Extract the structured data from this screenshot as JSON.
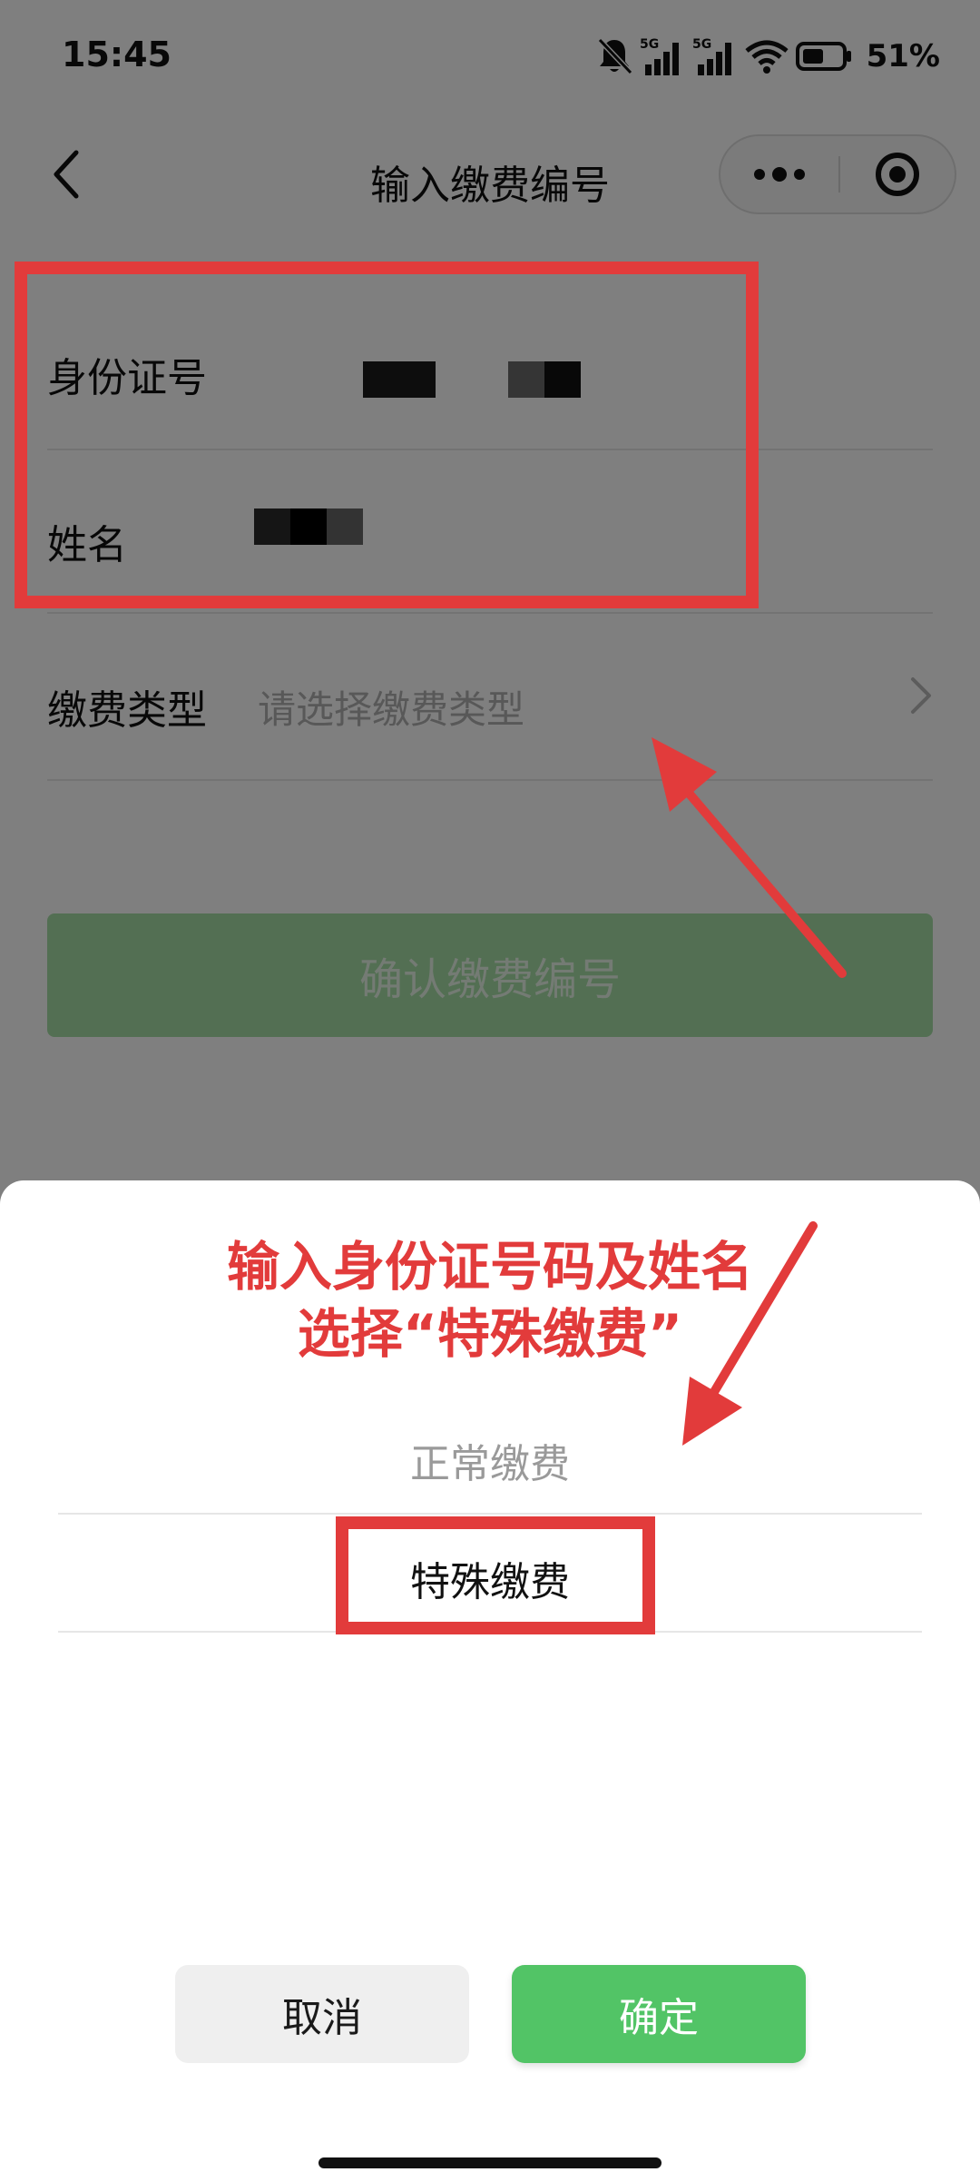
{
  "status_bar": {
    "time": "15:45",
    "network_badges": [
      "5G",
      "5G"
    ],
    "battery_percent": "51%",
    "icons": [
      "bell-muted-icon",
      "signal-5g-icon",
      "signal-5g-icon",
      "wifi-icon",
      "battery-icon"
    ]
  },
  "nav": {
    "title": "输入缴费编号",
    "back_icon": "chevron-left-icon",
    "more_icon": "more-dots-icon",
    "close_icon": "target-circle-icon"
  },
  "form": {
    "id_label": "身份证号",
    "name_label": "姓名",
    "type_label": "缴费类型",
    "type_placeholder": "请选择缴费类型",
    "confirm_label": "确认缴费编号"
  },
  "annotation": {
    "line1": "输入身份证号码及姓名",
    "line2": "选择“特殊缴费”",
    "color": "#e23b3b"
  },
  "picker": {
    "options": [
      "正常缴费",
      "特殊缴费"
    ],
    "selected": "特殊缴费",
    "cancel_label": "取消",
    "ok_label": "确定"
  },
  "colors": {
    "primary_green": "#52c466",
    "disabled_green": "#a6dfa6",
    "annotation_red": "#e23b3b"
  }
}
